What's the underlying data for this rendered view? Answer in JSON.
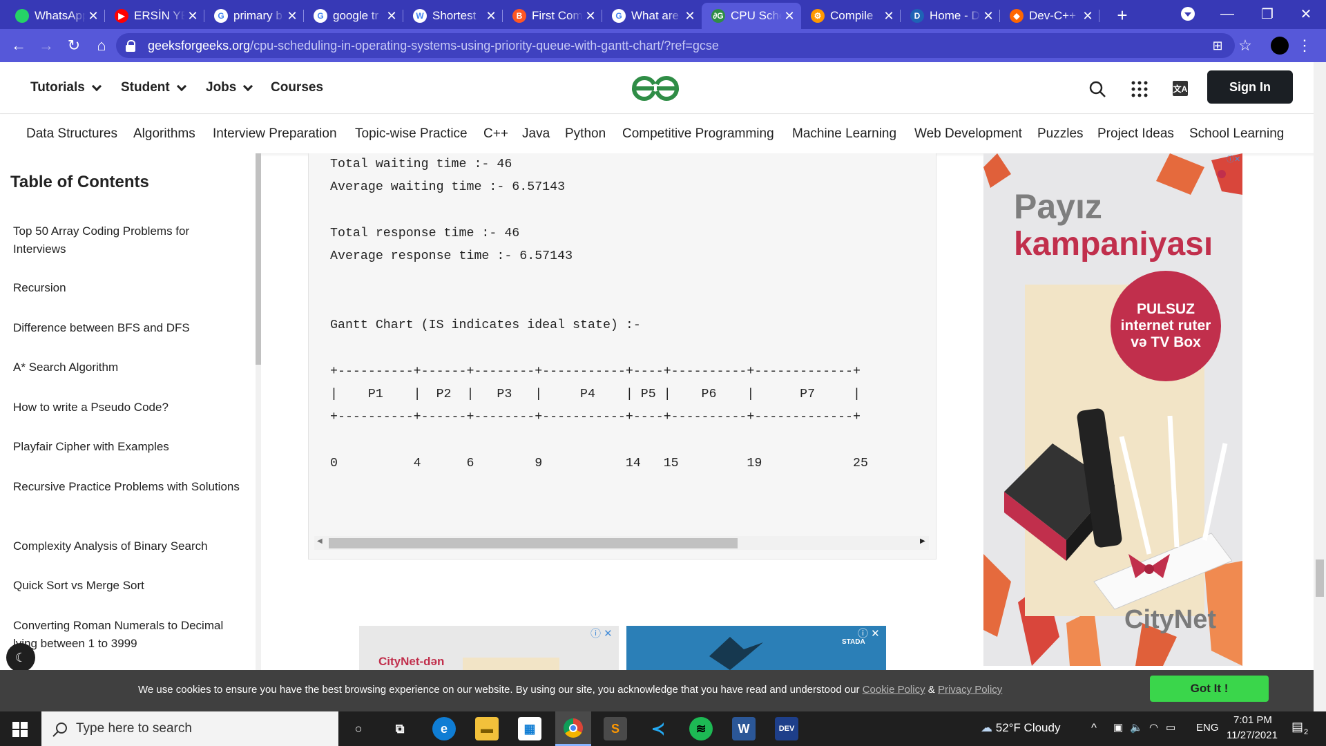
{
  "tabs": [
    {
      "title": "WhatsApp",
      "icon": "whatsapp-icon",
      "color": "#25d366",
      "glyph": ""
    },
    {
      "title": "ERSİN YEL",
      "icon": "youtube-icon",
      "color": "#ff0000",
      "glyph": "▶"
    },
    {
      "title": "primary b",
      "icon": "google-icon",
      "color": "#ffffff",
      "glyph": "G"
    },
    {
      "title": "google tr",
      "icon": "google-icon",
      "color": "#ffffff",
      "glyph": "G"
    },
    {
      "title": "Shortest",
      "icon": "wikipedia-icon",
      "color": "#ffffff",
      "glyph": "W"
    },
    {
      "title": "First Com",
      "icon": "blogger-icon",
      "color": "#ff5722",
      "glyph": "B"
    },
    {
      "title": "What are",
      "icon": "google-icon",
      "color": "#ffffff",
      "glyph": "G"
    },
    {
      "title": "CPU Sche",
      "icon": "gfg-icon",
      "color": "#2f8d46",
      "glyph": "∂G"
    },
    {
      "title": "Compile",
      "icon": "compiler-icon",
      "color": "#ff9800",
      "glyph": "⚙"
    },
    {
      "title": "Home - D",
      "icon": "devcpp-icon",
      "color": "#1e63b5",
      "glyph": "D"
    },
    {
      "title": "Dev-C++",
      "icon": "sourceforge-icon",
      "color": "#ff6600",
      "glyph": "◆"
    }
  ],
  "address": {
    "domain": "geeksforgeeks.org",
    "path": "/cpu-scheduling-in-operating-systems-using-priority-queue-with-gantt-chart/?ref=gcse"
  },
  "header": {
    "menu": [
      "Tutorials",
      "Student",
      "Jobs",
      "Courses"
    ],
    "sign_in": "Sign In"
  },
  "subnav": [
    "Data Structures",
    "Algorithms",
    "Interview Preparation",
    "Topic-wise Practice",
    "C++",
    "Java",
    "Python",
    "Competitive Programming",
    "Machine Learning",
    "Web Development",
    "Puzzles",
    "Project Ideas",
    "School Learning"
  ],
  "sidebar": {
    "title": "Table of Contents",
    "items": [
      "Top 50 Array Coding Problems for Interviews",
      "Recursion",
      "Difference between BFS and DFS",
      "A* Search Algorithm",
      "How to write a Pseudo Code?",
      "Playfair Cipher with Examples",
      "Recursive Practice Problems with Solutions",
      "Complexity Analysis of Binary Search",
      "Quick Sort vs Merge Sort",
      "Converting Roman Numerals to Decimal lying between 1 to 3999"
    ]
  },
  "code_output": {
    "lines": [
      "Total waiting time :- 46",
      "Average waiting time :- 6.57143",
      "",
      "Total response time :- 46",
      "Average response time :- 6.57143",
      "",
      "",
      "Gantt Chart (IS indicates ideal state) :-",
      "",
      "+----------+------+--------+-----------+----+----------+-------------+",
      "|    P1    |  P2  |   P3   |     P4    | P5 |    P6    |      P7     |",
      "+----------+------+--------+-----------+----+----------+-------------+",
      "",
      "0          4      6        9           14   15         19            25"
    ]
  },
  "ad_right": {
    "line1": "Payız",
    "line2": "kampaniyası",
    "badge": [
      "PULSUZ",
      "internet ruter",
      "və TV Box"
    ],
    "brand": "CityNet"
  },
  "ad_bottom": {
    "left_text": "CityNet-dən",
    "right_text": "STADA"
  },
  "cookie": {
    "text": "We use cookies to ensure you have the best browsing experience on our website. By using our site, you acknowledge that you have read and understood our ",
    "cookie_policy": "Cookie Policy",
    "amp": " & ",
    "privacy_policy": "Privacy Policy",
    "button": "Got It !"
  },
  "taskbar": {
    "search_placeholder": "Type here to search",
    "weather": "52°F  Cloudy",
    "lang": "ENG",
    "time": "7:01 PM",
    "date": "11/27/2021",
    "notifications": "2"
  },
  "colors": {
    "tab_bar": "#3739b6",
    "address_bar": "#5658d9",
    "gfg_green": "#2f8d46",
    "cookie_button": "#3ad64b"
  }
}
